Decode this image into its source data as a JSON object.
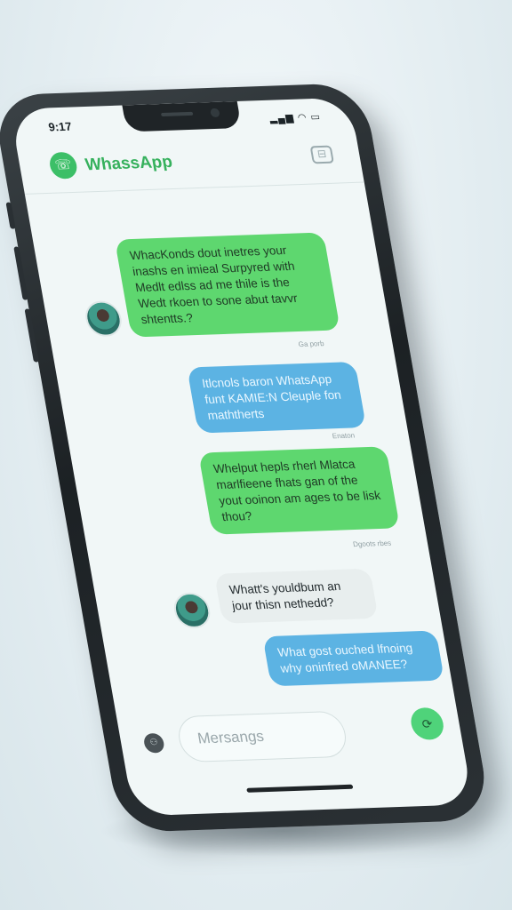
{
  "status": {
    "time": "9:17",
    "icons": "▂▄▆ ◠ ▭"
  },
  "header": {
    "title": "WhassApp",
    "logo_icon": "☏",
    "action_icon": "⊟"
  },
  "messages": [
    {
      "side": "in",
      "style": "green",
      "text": "WhacKonds dout inetres your inashs en imieal Surpyred with Medlt edlss ad me thile is the Wedt rkoen to sone abut tavvr shtentts.?",
      "time": "Ga porb"
    },
    {
      "side": "out",
      "style": "blue",
      "text": "Itlcnols baron WhatsApp funt KAMIE:N Cleuple fon maththerts",
      "time": "Enaton"
    },
    {
      "side": "out",
      "style": "green",
      "text": "Whelput hepls rherl Mlatca marlfieene fhats gan of the yout ooinon am ages to be lisk thou?",
      "time": "Dgoots rbes"
    },
    {
      "side": "in",
      "style": "gray",
      "text": "Whatt's youldbum an jour thisn nethedd?",
      "time": ""
    },
    {
      "side": "out",
      "style": "blue",
      "text": "What gost ouched lfnoing why oninfred oMANEE?",
      "time": ""
    }
  ],
  "composer": {
    "placeholder": "Mersangs",
    "attach_icon": "⚇",
    "send_icon": "⟳"
  },
  "colors": {
    "accent": "#36b15d",
    "green_bubble": "#5ed76f",
    "blue_bubble": "#5cb3e3"
  }
}
